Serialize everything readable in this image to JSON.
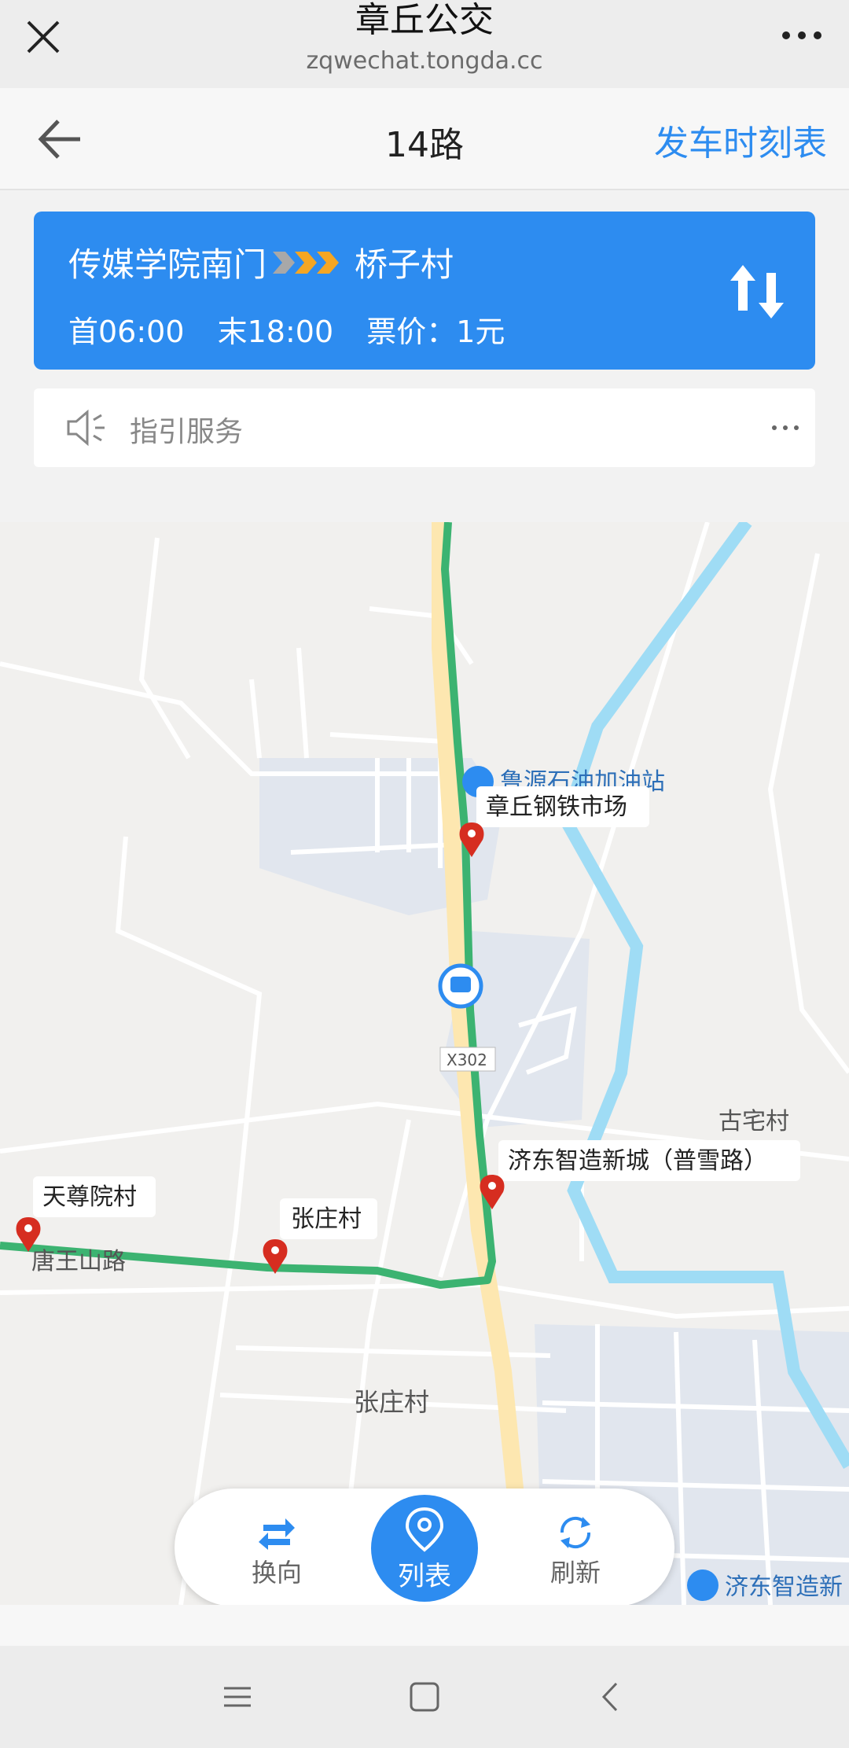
{
  "wechat": {
    "title": "章丘公交",
    "url": "zqwechat.tongda.cc"
  },
  "header": {
    "route_name": "14路",
    "timetable_label": "发车时刻表"
  },
  "route_card": {
    "from_stop": "传媒学院南门",
    "to_stop": "桥子村",
    "first_bus": "首06:00",
    "last_bus": "末18:00",
    "fare": "票价：1元"
  },
  "notice": {
    "text": "指引服务"
  },
  "map": {
    "stop_labels": [
      "章丘钢铁市场",
      "济东智造新城（普雪路）",
      "天尊院村",
      "张庄村"
    ],
    "place_labels": {
      "gas_station": "鲁源石油加油站",
      "road_x302": "X302",
      "village_gu": "古宅村",
      "road_tang": "唐王山路",
      "village_zhang": "张庄村",
      "poi_jidong": "济东智造新"
    }
  },
  "controls": {
    "reverse_label": "换向",
    "list_label": "列表",
    "refresh_label": "刷新"
  },
  "colors": {
    "accent": "#2d8cf0",
    "route_line": "#3cb371",
    "river": "#9fdcf5",
    "highway": "#fde7b0",
    "stop_pin": "#d62d20"
  }
}
